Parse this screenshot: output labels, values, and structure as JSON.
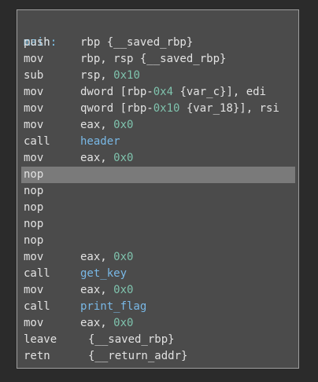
{
  "colors": {
    "background": "#2b2b2b",
    "panel": "#4b4b4b",
    "selection": "#7a7a7a",
    "label": "#7ec7ef",
    "number": "#7fc3ad",
    "function": "#79b8e6",
    "text": "#e2e2e2"
  },
  "function_label": "main:",
  "instructions": [
    {
      "mnemonic": "push",
      "operands": "rbp {__saved_rbp}"
    },
    {
      "mnemonic": "mov",
      "operands": "rbp, rsp {__saved_rbp}"
    },
    {
      "mnemonic": "sub",
      "operands": "rsp, 0x10"
    },
    {
      "mnemonic": "mov",
      "operands": "dword [rbp-0x4 {var_c}], edi"
    },
    {
      "mnemonic": "mov",
      "operands": "qword [rbp-0x10 {var_18}], rsi"
    },
    {
      "mnemonic": "mov",
      "operands": "eax, 0x0"
    },
    {
      "mnemonic": "call",
      "operands": "header"
    },
    {
      "mnemonic": "mov",
      "operands": "eax, 0x0"
    },
    {
      "mnemonic": "nop",
      "operands": ""
    },
    {
      "mnemonic": "nop",
      "operands": ""
    },
    {
      "mnemonic": "nop",
      "operands": ""
    },
    {
      "mnemonic": "nop",
      "operands": ""
    },
    {
      "mnemonic": "nop",
      "operands": ""
    },
    {
      "mnemonic": "mov",
      "operands": "eax, 0x0"
    },
    {
      "mnemonic": "call",
      "operands": "get_key"
    },
    {
      "mnemonic": "mov",
      "operands": "eax, 0x0"
    },
    {
      "mnemonic": "call",
      "operands": "print_flag"
    },
    {
      "mnemonic": "mov",
      "operands": "eax, 0x0"
    },
    {
      "mnemonic": "leave",
      "operands": "{__saved_rbp}"
    },
    {
      "mnemonic": "retn",
      "operands": "{__return_addr}"
    }
  ],
  "selected_index": 8
}
